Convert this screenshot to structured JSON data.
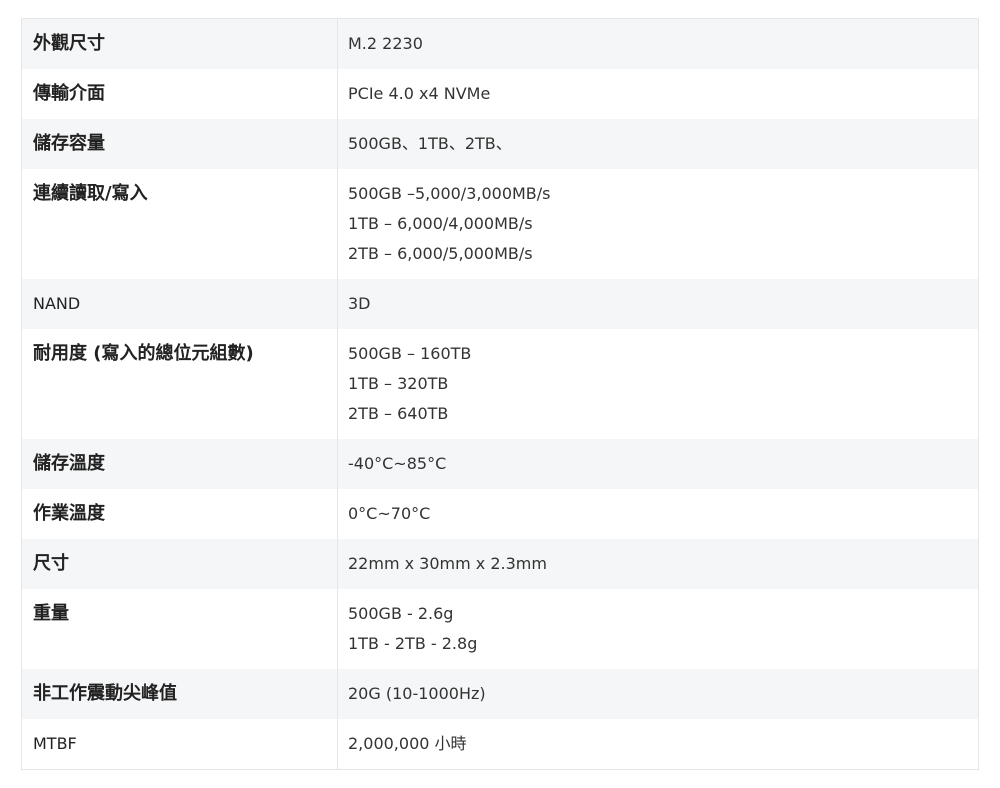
{
  "rows": [
    {
      "label": "外觀尺寸",
      "values": [
        "M.2 2230"
      ]
    },
    {
      "label": "傳輸介面",
      "values": [
        "PCIe 4.0 x4 NVMe"
      ]
    },
    {
      "label": "儲存容量",
      "values": [
        "500GB、1TB、2TB、"
      ]
    },
    {
      "label": "連續讀取/寫入",
      "values": [
        "500GB –5,000/3,000MB/s",
        "1TB – 6,000/4,000MB/s",
        "2TB – 6,000/5,000MB/s"
      ]
    },
    {
      "label": "NAND",
      "values": [
        "3D"
      ]
    },
    {
      "label": "耐用度 (寫入的總位元組數)",
      "values": [
        "500GB – 160TB",
        "1TB – 320TB",
        "2TB – 640TB"
      ]
    },
    {
      "label": "儲存溫度",
      "values": [
        "-40°C~85°C"
      ]
    },
    {
      "label": "作業溫度",
      "values": [
        "0°C~70°C"
      ]
    },
    {
      "label": "尺寸",
      "values": [
        "22mm x 30mm x 2.3mm"
      ]
    },
    {
      "label": "重量",
      "values": [
        "500GB - 2.6g",
        "1TB - 2TB - 2.8g"
      ]
    },
    {
      "label": "非工作震動尖峰值",
      "values": [
        "20G (10-1000Hz)"
      ]
    },
    {
      "label": "MTBF",
      "values": [
        "2,000,000 小時"
      ]
    }
  ]
}
